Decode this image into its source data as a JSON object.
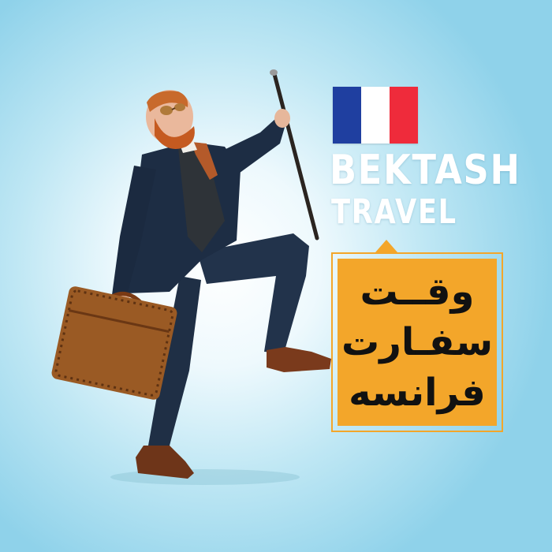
{
  "brand": {
    "line1": "BEKTASH",
    "line2": "TRAVEL"
  },
  "flag": {
    "name": "france-flag",
    "colors": [
      "#1f3fa0",
      "#ffffff",
      "#ef2b3b"
    ]
  },
  "callout": {
    "lines": [
      "وقــت",
      "سفـارت",
      "فرانسه"
    ],
    "background_color": "#f3a62a",
    "text_color": "#111111"
  },
  "photo": {
    "subject": "man-in-suit-with-cane-and-briefcase"
  }
}
